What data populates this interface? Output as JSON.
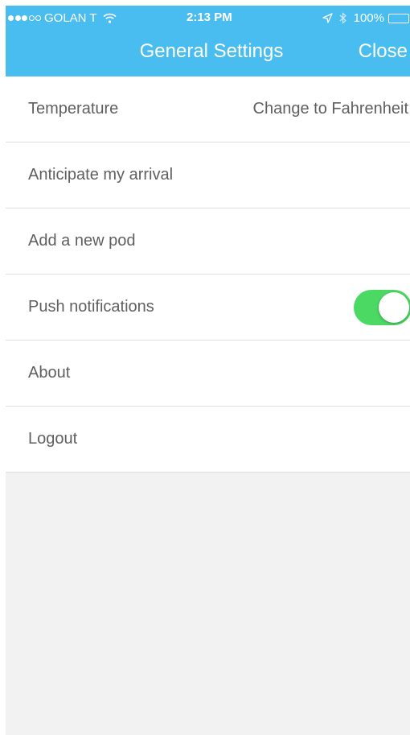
{
  "status_bar": {
    "carrier": "GOLAN T",
    "time": "2:13 PM",
    "battery": "100%",
    "signal_bars_filled": 3,
    "signal_bars_total": 5,
    "battery_level": 1.0,
    "icons": [
      "wifi-icon",
      "location-arrow-icon",
      "bluetooth-icon",
      "battery-icon",
      "charging-icon"
    ]
  },
  "nav": {
    "title": "General Settings",
    "close_label": "Close"
  },
  "settings": {
    "items": [
      {
        "label": "Temperature",
        "value": "Change to Fahrenheit"
      },
      {
        "label": "Anticipate my arrival"
      },
      {
        "label": "Add a new pod"
      },
      {
        "label": "Push notifications",
        "toggle_on": true
      },
      {
        "label": "About"
      },
      {
        "label": "Logout"
      }
    ]
  },
  "colors": {
    "header_bg": "#49bdf0",
    "toggle_on": "#4bd863",
    "background": "#f2f2f3",
    "row_text": "#5f5f5f",
    "separator": "#dfdfe1"
  }
}
